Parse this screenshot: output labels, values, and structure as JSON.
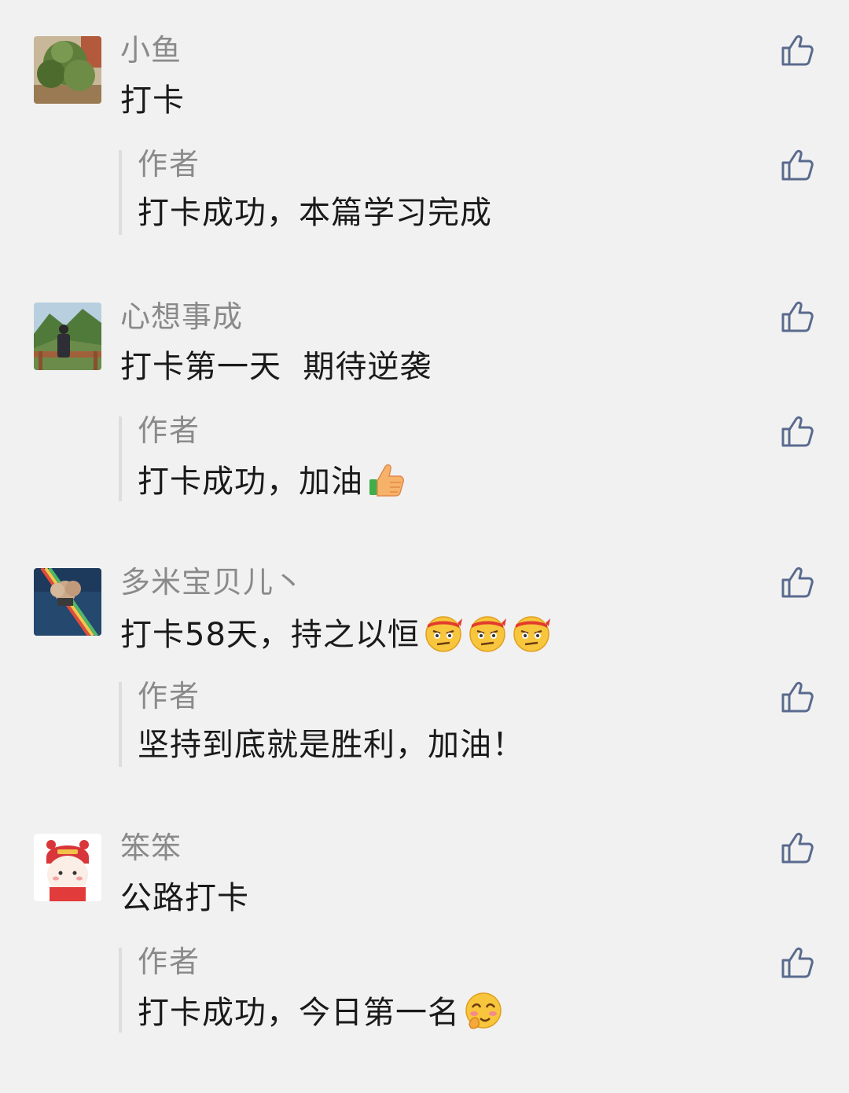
{
  "comments": [
    {
      "username": "小鱼",
      "text": "打卡",
      "text_emojis": [],
      "avatar": "tree-photo",
      "reply": {
        "author": "作者",
        "text": "打卡成功，本篇学习完成",
        "emojis": []
      }
    },
    {
      "username": "心想事成",
      "text": "打卡第一天  期待逆袭",
      "text_emojis": [],
      "avatar": "mountain-person-photo",
      "reply": {
        "author": "作者",
        "text": "打卡成功，加油",
        "emojis": [
          "thumbs-up-emoji"
        ]
      }
    },
    {
      "username": "多米宝贝儿丶",
      "text": "打卡58天，持之以恒",
      "text_emojis": [
        "determined-face-emoji",
        "determined-face-emoji",
        "determined-face-emoji"
      ],
      "avatar": "rainbow-sea-photo",
      "reply": {
        "author": "作者",
        "text": "坚持到底就是胜利，加油！",
        "emojis": []
      }
    },
    {
      "username": "笨笨",
      "text": "公路打卡",
      "text_emojis": [],
      "avatar": "cartoon-girl-avatar",
      "reply": {
        "author": "作者",
        "text": "打卡成功，今日第一名",
        "emojis": [
          "giggle-face-emoji"
        ]
      }
    }
  ],
  "icons": {
    "like": "thumbs-up-outline-icon"
  },
  "colors": {
    "background": "#f1f1f1",
    "username": "#8a8a8a",
    "text": "#1a1a1a",
    "like_icon": "#5a6a8e",
    "reply_bar": "#dddddd"
  }
}
